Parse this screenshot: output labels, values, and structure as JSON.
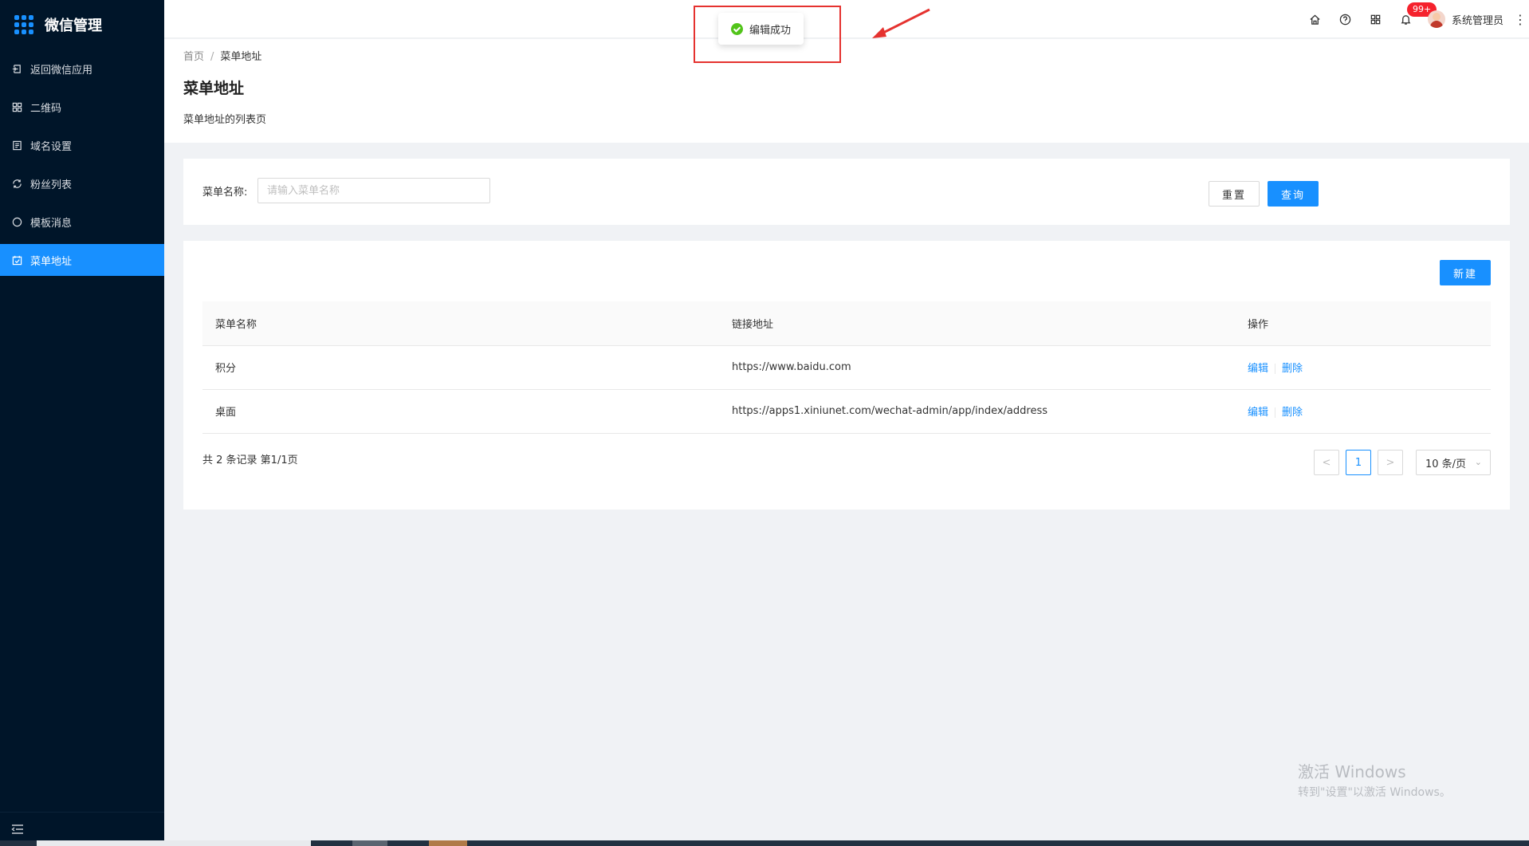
{
  "app": {
    "title": "微信管理"
  },
  "sidebar": {
    "items": [
      {
        "label": "返回微信应用",
        "icon": "return-icon"
      },
      {
        "label": "二维码",
        "icon": "qrcode-icon"
      },
      {
        "label": "域名设置",
        "icon": "document-icon"
      },
      {
        "label": "粉丝列表",
        "icon": "refresh-icon"
      },
      {
        "label": "模板消息",
        "icon": "message-icon"
      },
      {
        "label": "菜单地址",
        "icon": "schedule-icon",
        "active": true
      }
    ]
  },
  "header": {
    "notification_count": "99+",
    "user_name": "系统管理员"
  },
  "toast": {
    "message": "编辑成功"
  },
  "page": {
    "breadcrumb": {
      "home": "首页",
      "separator": "/",
      "current": "菜单地址"
    },
    "title": "菜单地址",
    "description": "菜单地址的列表页"
  },
  "search": {
    "label": "菜单名称:",
    "placeholder": "请输入菜单名称",
    "reset_label": "重置",
    "query_label": "查询"
  },
  "table": {
    "new_label": "新建",
    "columns": [
      "菜单名称",
      "链接地址",
      "操作"
    ],
    "rows": [
      {
        "name": "积分",
        "url": "https://www.baidu.com",
        "edit": "编辑",
        "delete": "删除"
      },
      {
        "name": "桌面",
        "url": "https://apps1.xiniunet.com/wechat-admin/app/index/address",
        "edit": "编辑",
        "delete": "删除"
      }
    ]
  },
  "pagination": {
    "summary": "共 2 条记录 第1/1页",
    "current_page": "1",
    "prev": "<",
    "next": ">",
    "page_size": "10 条/页"
  },
  "watermark": {
    "title": "激活 Windows",
    "subtitle": "转到\"设置\"以激活 Windows。"
  },
  "colors": {
    "sidebar_bg": "#001529",
    "primary": "#1890ff",
    "badge": "#f5222d",
    "success": "#52c41a",
    "annotation": "#e5322f"
  }
}
